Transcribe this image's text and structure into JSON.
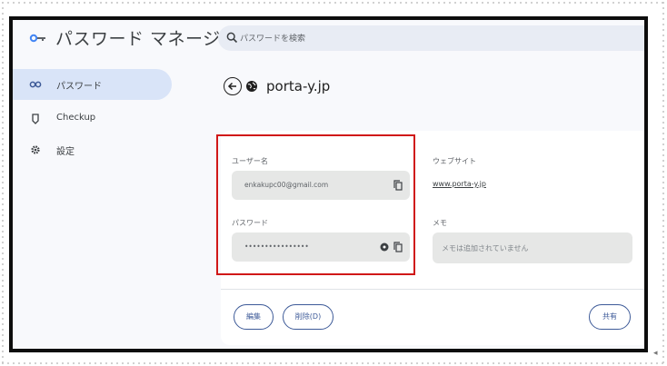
{
  "app": {
    "title": "パスワード マネージャー"
  },
  "search": {
    "placeholder": "パスワードを検索"
  },
  "sidebar": {
    "items": [
      {
        "label": "パスワード",
        "icon": "key-icon",
        "active": true
      },
      {
        "label": "Checkup",
        "icon": "shield-check-icon",
        "active": false
      },
      {
        "label": "設定",
        "icon": "gear-icon",
        "active": false
      }
    ]
  },
  "detail": {
    "site": "porta-y.jp",
    "username_label": "ユーザー名",
    "username_value": "enkakupc00@gmail.com",
    "password_label": "パスワード",
    "password_value": "••••••••••••••••",
    "website_label": "ウェブサイト",
    "website_value": "www.porta-y.jp",
    "note_label": "メモ",
    "note_placeholder": "メモは追加されていません",
    "edit_label": "編集",
    "delete_label": "削除(D)",
    "share_label": "共有"
  },
  "colors": {
    "accent": "#3d5a98",
    "highlight": "#d01818",
    "active_nav": "#d9e4f8",
    "field_bg": "#e6e7e6"
  }
}
